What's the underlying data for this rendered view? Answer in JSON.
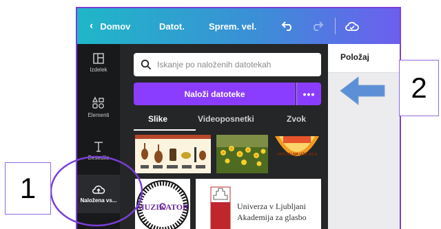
{
  "topbar": {
    "back_label": "Domov",
    "file_label": "Datot.",
    "resize_label": "Sprem. vel.",
    "icons": [
      "chevron-left-icon",
      "undo-icon",
      "redo-icon",
      "cloud-sync-icon"
    ]
  },
  "rail": {
    "items": [
      {
        "label": "Izdelek",
        "icon": "layout-icon"
      },
      {
        "label": "Elementi",
        "icon": "shapes-icon"
      },
      {
        "label": "Besedilo",
        "icon": "text-icon"
      },
      {
        "label": "Naložena vs...",
        "icon": "cloud-upload-icon"
      }
    ]
  },
  "panel": {
    "search_placeholder": "Iskanje po naloženih datotekah",
    "upload_label": "Naloži datoteke",
    "more_label": "•••",
    "tabs": [
      "Slike",
      "Videoposnetki",
      "Zvok"
    ],
    "active_tab": "Slike",
    "thumbnails": [
      {
        "kind": "instruments-chart"
      },
      {
        "kind": "daffodils-photo"
      },
      {
        "kind": "virtual-classroom-logo",
        "text": "VIRTUALNA UČILNICA"
      },
      {
        "kind": "muzikator-logo",
        "text": "MUZIKATOR"
      },
      {
        "kind": "university-logo",
        "line1": "Univerza v Ljubljani",
        "line2": "Akademija za glasbo"
      }
    ]
  },
  "props": {
    "title": "Položaj"
  },
  "annotations": {
    "callout_1": "1",
    "callout_2": "2",
    "colors": {
      "circle": "#7a3fd6",
      "arrow": "#5b8fd6"
    }
  },
  "colors": {
    "accent": "#8b3dff",
    "topbar_start": "#1fb7c8",
    "topbar_end": "#6d5ef0",
    "dark_bg": "#18191b",
    "panel_bg": "#252627"
  }
}
